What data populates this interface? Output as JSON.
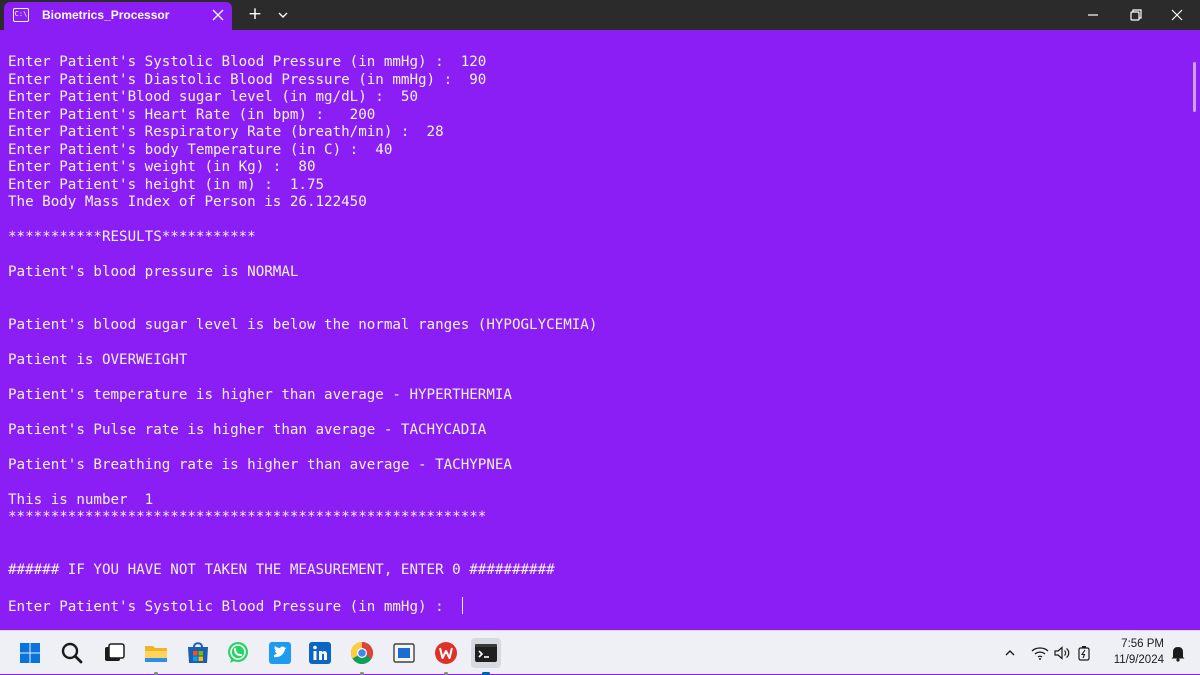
{
  "window": {
    "tab_title": "Biometrics_Processor",
    "tab_icon_text": "C:\\",
    "new_tab_label": "+"
  },
  "console": {
    "lines": [
      "Enter Patient's Systolic Blood Pressure (in mmHg) :  120",
      "Enter Patient's Diastolic Blood Pressure (in mmHg) :  90",
      "Enter Patient'Blood sugar level (in mg/dL) :  50",
      "Enter Patient's Heart Rate (in bpm) :   200",
      "Enter Patient's Respiratory Rate (breath/min) :  28",
      "Enter Patient's body Temperature (in C) :  40",
      "Enter Patient's weight (in Kg) :  80",
      "Enter Patient's height (in m) :  1.75",
      "The Body Mass Index of Person is 26.122450",
      "",
      "***********RESULTS***********",
      "",
      "Patient's blood pressure is NORMAL",
      "",
      "",
      "Patient's blood sugar level is below the normal ranges (HYPOGLYCEMIA)",
      "",
      "Patient is OVERWEIGHT",
      "",
      "Patient's temperature is higher than average - HYPERTHERMIA",
      "",
      "Patient's Pulse rate is higher than average - TACHYCADIA",
      "",
      "Patient's Breathing rate is higher than average - TACHYPNEA",
      "",
      "This is number  1",
      "********************************************************",
      "",
      "",
      "###### IF YOU HAVE NOT TAKEN THE MEASUREMENT, ENTER 0 ##########",
      "",
      "Enter Patient's Systolic Blood Pressure (in mmHg) :  "
    ]
  },
  "taskbar": {
    "apps": [
      "windows-start",
      "search",
      "task-view",
      "file-explorer",
      "microsoft-store",
      "whatsapp",
      "twitter",
      "linkedin",
      "chrome",
      "app-window",
      "wps-office",
      "terminal"
    ],
    "tray": {
      "time": "7:56 PM",
      "date": "11/9/2024"
    }
  },
  "colors": {
    "terminal_bg": "#8b1ef5",
    "titlebar_bg": "#2b2b2b",
    "taskbar_bg": "#eef0f5",
    "text": "#f2f2f2"
  }
}
